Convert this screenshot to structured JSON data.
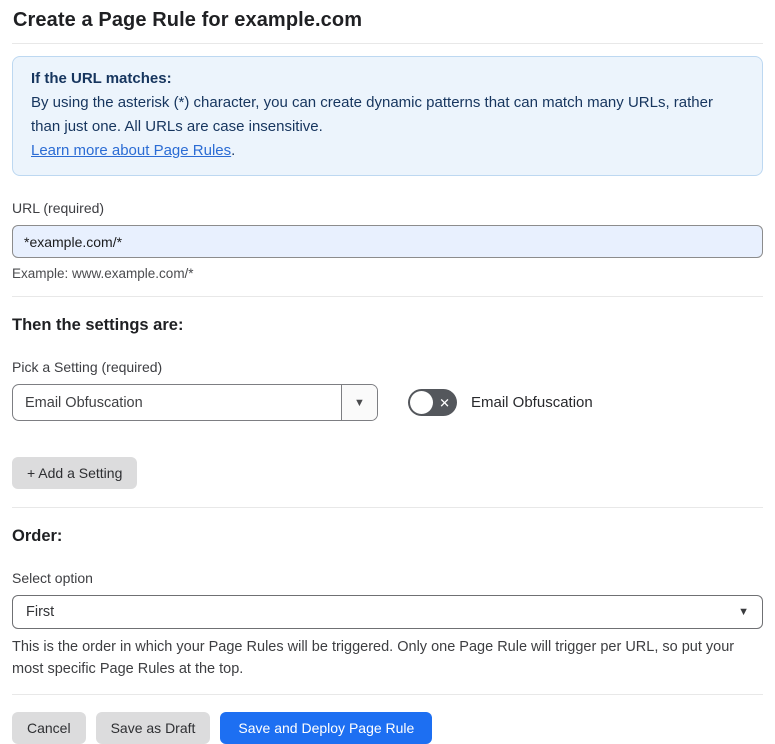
{
  "page": {
    "title": "Create a Page Rule for example.com"
  },
  "info_box": {
    "heading": "If the URL matches:",
    "body": "By using the asterisk (*) character, you can create dynamic patterns that can match many URLs, rather than just one. All URLs are case insensitive.",
    "link_label": "Learn more about Page Rules",
    "link_suffix": "."
  },
  "url_field": {
    "label": "URL (required)",
    "value": "*example.com/*",
    "helper": "Example: www.example.com/*"
  },
  "settings_section": {
    "heading": "Then the settings are:",
    "picker_label": "Pick a Setting (required)",
    "picker_value": "Email Obfuscation",
    "toggle_state": "off",
    "toggle_off_glyph": "✕",
    "toggle_label": "Email Obfuscation",
    "add_setting_label": "+ Add a Setting"
  },
  "order_section": {
    "heading": "Order:",
    "select_label": "Select option",
    "select_value": "First",
    "helper": "This is the order in which your Page Rules will be triggered. Only one Page Rule will trigger per URL, so put your most specific Page Rules at the top."
  },
  "footer": {
    "cancel_label": "Cancel",
    "save_draft_label": "Save as Draft",
    "save_deploy_label": "Save and Deploy Page Rule"
  },
  "icons": {
    "dropdown_arrow": "▼"
  },
  "colors": {
    "accent_blue": "#1d6ff2",
    "info_bg": "#ecf4fc",
    "info_border": "#bdd8f1",
    "info_text": "#16355e",
    "link_blue": "#2b6cd4",
    "input_autofill_bg": "#e8f0fe",
    "toggle_off_bg": "#54575c",
    "gray_button_bg": "#dcdcdd"
  }
}
